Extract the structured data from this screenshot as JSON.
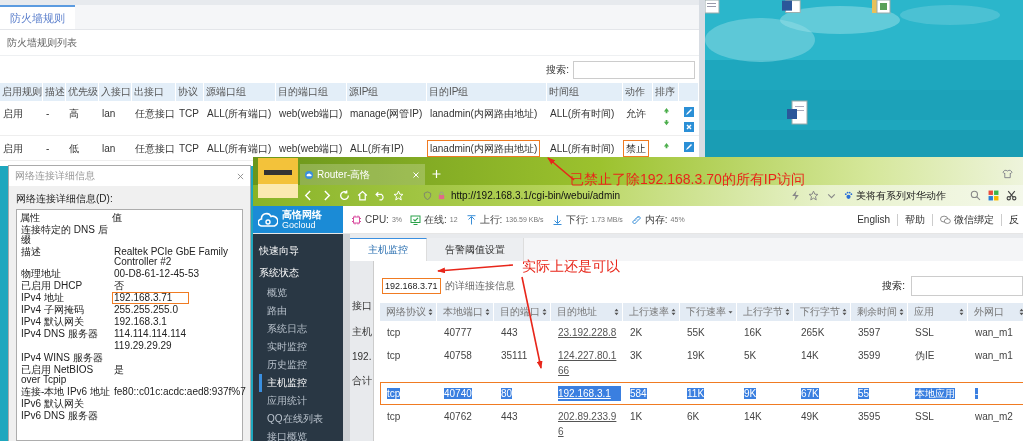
{
  "firewall": {
    "tab": {
      "label": "防火墙规则",
      "selected": true
    },
    "list_title": "防火墙规则列表",
    "search": {
      "label": "搜索:"
    },
    "columns": [
      "启用规则",
      "描述",
      "优先级",
      "入接口",
      "出接口",
      "协议",
      "源端口组",
      "目的端口组",
      "源IP组",
      "目的IP组",
      "时间组",
      "动作",
      "排序"
    ],
    "rows": [
      {
        "cells": [
          {
            "text": "启用",
            "boxed": false
          },
          {
            "text": "-",
            "boxed": false
          },
          {
            "text": "高",
            "boxed": false
          },
          {
            "text": "lan",
            "boxed": false
          },
          {
            "text": "任意接口",
            "boxed": false
          },
          {
            "text": "TCP",
            "boxed": false
          },
          {
            "text": "ALL(所有端口)",
            "boxed": false
          },
          {
            "text": "web(web端口)",
            "boxed": false
          },
          {
            "text": "manage(网管IP)",
            "boxed": false
          },
          {
            "text": "lanadmin(内网路由地址)",
            "boxed": false
          },
          {
            "text": "ALL(所有时间)",
            "boxed": false
          },
          {
            "text": "允许",
            "boxed": false
          }
        ]
      },
      {
        "cells": [
          {
            "text": "启用",
            "boxed": false
          },
          {
            "text": "-",
            "boxed": false
          },
          {
            "text": "低",
            "boxed": false
          },
          {
            "text": "lan",
            "boxed": false
          },
          {
            "text": "任意接口",
            "boxed": false
          },
          {
            "text": "TCP",
            "boxed": false
          },
          {
            "text": "ALL(所有端口)",
            "boxed": false
          },
          {
            "text": "web(web端口)",
            "boxed": false
          },
          {
            "text": "ALL(所有IP)",
            "boxed": false
          },
          {
            "text": "lanadmin(内网路由地址)",
            "boxed": true
          },
          {
            "text": "ALL(所有时间)",
            "boxed": false
          },
          {
            "text": "禁止",
            "boxed": true
          }
        ]
      }
    ]
  },
  "network_details": {
    "title": "网络连接详细信息",
    "list_label": "网络连接详细信息(D):",
    "columns": [
      "属性",
      "值"
    ],
    "rows": [
      {
        "property": "连接特定的 DNS 后缀",
        "boxed": false
      },
      {
        "property": "描述",
        "value": "Realtek PCIe GbE Family Controller #2",
        "boxed": false
      },
      {
        "property": "物理地址",
        "value": "00-D8-61-12-45-53",
        "boxed": false
      },
      {
        "property": "已启用 DHCP",
        "value": "否",
        "boxed": false
      },
      {
        "property": "IPv4 地址",
        "value": "192.168.3.71",
        "boxed": true
      },
      {
        "property": "IPv4 子网掩码",
        "value": "255.255.255.0",
        "boxed": false
      },
      {
        "property": "IPv4 默认网关",
        "value": "192.168.3.1",
        "boxed": false
      },
      {
        "property": "IPv4 DNS 服务器",
        "value": "114.114.114.114",
        "boxed": false
      },
      {
        "value": "119.29.29.29",
        "boxed": false
      },
      {
        "property": "IPv4 WINS 服务器",
        "boxed": false
      },
      {
        "property": "已启用 NetBIOS over Tcpip",
        "value": "是",
        "boxed": false
      },
      {
        "property": "连接-本地 IPv6 地址",
        "value": "fe80::c01c:acdc:aed8:937f%7",
        "boxed": false
      },
      {
        "property": "IPv6 默认网关",
        "boxed": false
      },
      {
        "property": "IPv6 DNS 服务器",
        "boxed": false
      }
    ]
  },
  "browser": {
    "tab": {
      "title": "Router-高恪"
    },
    "url": "http://192.168.3.1/cgi-bin/webui/admin",
    "bookmark": "美将有系列对华动作",
    "brand": {
      "name": "高恪网络",
      "sub": "Gocloud"
    },
    "stats": [
      {
        "kind": "cpu",
        "label": "CPU:",
        "value": "3%"
      },
      {
        "kind": "online",
        "label": "在线:",
        "value": "12"
      },
      {
        "kind": "upload",
        "label": "上行:",
        "value": "136.59 KB/s"
      },
      {
        "kind": "download",
        "label": "下行:",
        "value": "1.73 MB/s"
      },
      {
        "kind": "memory",
        "label": "内存:",
        "value": "45%"
      }
    ],
    "links": [
      {
        "kind": "text",
        "label": "English"
      },
      {
        "kind": "text",
        "label": "帮助"
      },
      {
        "kind": "wechat",
        "label": "微信绑定"
      },
      {
        "kind": "text",
        "label": "反"
      }
    ],
    "sidebar": {
      "sections": [
        "快速向导",
        "系统状态"
      ],
      "items": [
        {
          "label": "概览",
          "selected": false
        },
        {
          "label": "路由",
          "selected": false
        },
        {
          "label": "系统日志",
          "selected": false
        },
        {
          "label": "实时监控",
          "selected": false
        },
        {
          "label": "历史监控",
          "selected": false
        },
        {
          "label": "主机监控",
          "selected": true
        },
        {
          "label": "应用统计",
          "selected": false
        },
        {
          "label": "QQ在线列表",
          "selected": false
        },
        {
          "label": "接口概览",
          "selected": false
        }
      ]
    },
    "tabs": [
      {
        "label": "主机监控",
        "selected": true
      },
      {
        "label": "告警阈值设置",
        "selected": false
      }
    ],
    "behind_labels": [
      "接口",
      "主机",
      "192.",
      "合计"
    ],
    "modal": {
      "title": {
        "ip": "192.168.3.71",
        "suffix": "的详细连接信息",
        "boxed": true
      },
      "search": {
        "label": "搜索:"
      },
      "columns": [
        {
          "label": "网络协议",
          "sorted": false,
          "kind": "text"
        },
        {
          "label": "本地端口",
          "sorted": false,
          "kind": "text"
        },
        {
          "label": "目的端口",
          "sorted": false,
          "kind": "text"
        },
        {
          "label": "目的地址",
          "sorted": false,
          "kind": "link"
        },
        {
          "label": "上行速率",
          "sorted": false,
          "kind": "text"
        },
        {
          "label": "下行速率",
          "sorted": true,
          "kind": "text"
        },
        {
          "label": "上行字节",
          "sorted": false,
          "kind": "text"
        },
        {
          "label": "下行字节",
          "sorted": false,
          "kind": "text"
        },
        {
          "label": "剩余时间",
          "sorted": false,
          "kind": "text"
        },
        {
          "label": "应用",
          "sorted": false,
          "kind": "text"
        },
        {
          "label": "外网口",
          "sorted": false,
          "kind": "text"
        }
      ],
      "rows": [
        {
          "cells": [
            "tcp",
            "40777",
            "443",
            "23.192.228.8",
            "2K",
            "55K",
            "16K",
            "265K",
            "3597",
            "SSL",
            "wan_m1"
          ],
          "selected": false,
          "boxed": false
        },
        {
          "cells": [
            "tcp",
            "40758",
            "35111",
            "124.227.80.166",
            "3K",
            "19K",
            "5K",
            "14K",
            "3599",
            "伪IE",
            "wan_m1"
          ],
          "selected": false,
          "boxed": false
        },
        {
          "cells": [
            "tcp",
            "40740",
            "80",
            "192.168.3.1",
            "584",
            "11K",
            "9K",
            "67K",
            "55",
            "本地应用",
            "-"
          ],
          "selected": true,
          "boxed": true
        },
        {
          "cells": [
            "tcp",
            "40762",
            "443",
            "202.89.233.96",
            "1K",
            "6K",
            "14K",
            "49K",
            "3595",
            "SSL",
            "wan_m2"
          ],
          "selected": false,
          "boxed": false
        }
      ]
    }
  },
  "annotations": [
    {
      "text": "已禁止了除192.168.3.70的所有IP访问"
    },
    {
      "text": "实际上还是可以"
    }
  ]
}
